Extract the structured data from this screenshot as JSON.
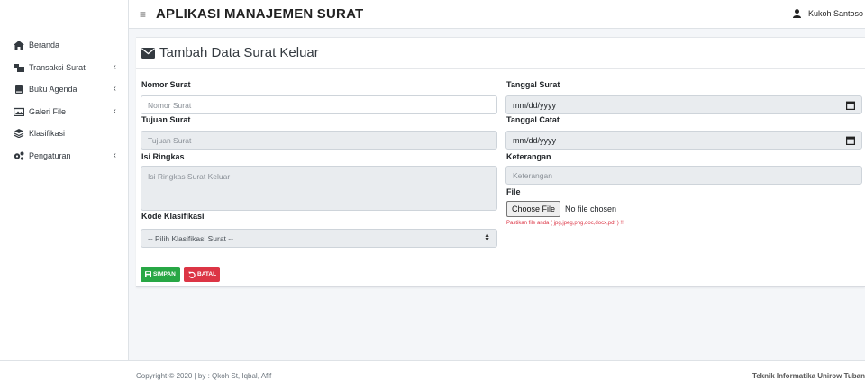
{
  "app": {
    "title": "APLIKASI MANAJEMEN SURAT",
    "user_name": "Kukoh Santoso"
  },
  "sidebar": {
    "items": [
      {
        "label": "Beranda",
        "icon": "home-icon",
        "has_children": false
      },
      {
        "label": "Transaksi Surat",
        "icon": "mail-bulk-icon",
        "has_children": true
      },
      {
        "label": "Buku Agenda",
        "icon": "book-icon",
        "has_children": true
      },
      {
        "label": "Galeri File",
        "icon": "images-icon",
        "has_children": true
      },
      {
        "label": "Klasifikasi",
        "icon": "layers-icon",
        "has_children": false
      },
      {
        "label": "Pengaturan",
        "icon": "cogs-icon",
        "has_children": true
      }
    ],
    "chevron": "‹"
  },
  "form": {
    "title": "Tambah Data Surat Keluar",
    "nomor_surat": {
      "label": "Nomor Surat",
      "placeholder": "Nomor Surat"
    },
    "tujuan_surat": {
      "label": "Tujuan Surat",
      "placeholder": "Tujuan Surat"
    },
    "isi_ringkas": {
      "label": "Isi Ringkas",
      "placeholder": "Isi Ringkas Surat Keluar"
    },
    "kode_klasifikasi": {
      "label": "Kode Klasifikasi",
      "selected": "-- Pilih Klasifikasi Surat --"
    },
    "tanggal_surat": {
      "label": "Tanggal Surat",
      "value": "mm/dd/yyyy"
    },
    "tanggal_catat": {
      "label": "Tanggal Catat",
      "value": "mm/dd/yyyy"
    },
    "keterangan": {
      "label": "Keterangan",
      "placeholder": "Keterangan"
    },
    "file": {
      "label": "File",
      "button": "Choose File",
      "status": "No file chosen",
      "note": "Pastikan file anda ( jpg,jpeg,png,doc,docx,pdf ) !!!"
    },
    "save_label": "SIMPAN",
    "cancel_label": "BATAL"
  },
  "footer": {
    "left": "Copyright © 2020 | by : Qkoh St, Iqbal, Afif",
    "right": "Teknik Informatika Unirow Tuban"
  },
  "colors": {
    "save": "#28a745",
    "cancel": "#dc3545",
    "sidebar_bg": "#ffffff",
    "content_bg": "#f4f6f9"
  }
}
